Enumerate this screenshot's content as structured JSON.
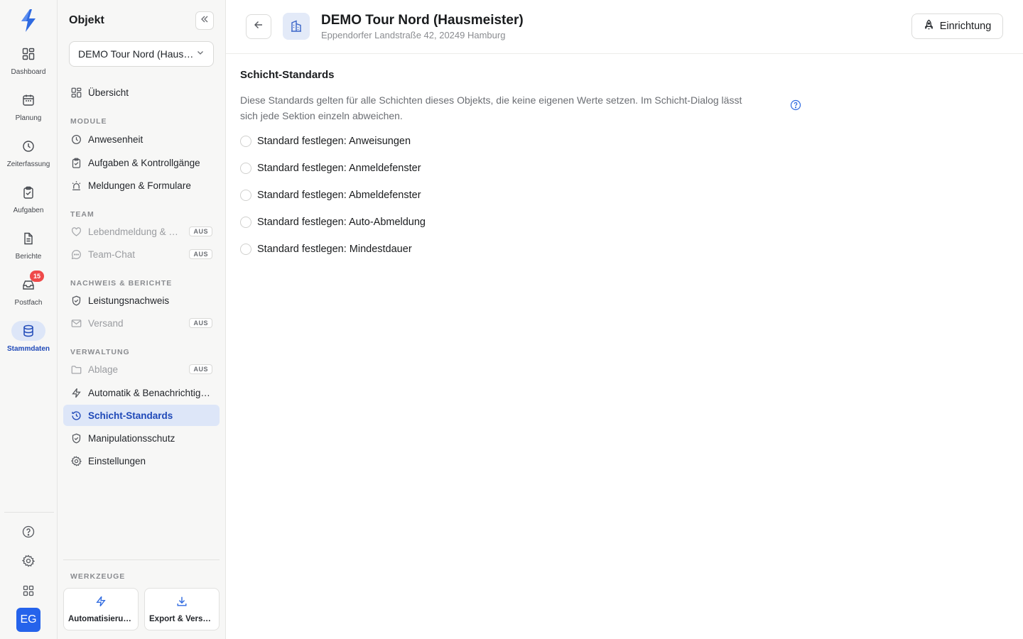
{
  "rail": {
    "items": [
      {
        "label": "Dashboard",
        "icon": "dashboard-icon"
      },
      {
        "label": "Planung",
        "icon": "calendar-icon"
      },
      {
        "label": "Zeiterfassung",
        "icon": "clock-icon"
      },
      {
        "label": "Aufgaben",
        "icon": "clipboard-check-icon"
      },
      {
        "label": "Berichte",
        "icon": "document-icon"
      },
      {
        "label": "Postfach",
        "icon": "inbox-icon",
        "badge": "15"
      },
      {
        "label": "Stammdaten",
        "icon": "database-icon",
        "active": true
      }
    ],
    "avatar": "EG"
  },
  "sidebar": {
    "title": "Objekt",
    "object_select": "DEMO Tour Nord (Hausmeister)",
    "overview": "Übersicht",
    "sections": {
      "module": "MODULE",
      "team": "TEAM",
      "nachweis": "NACHWEIS & BERICHTE",
      "verwaltung": "VERWALTUNG",
      "werkzeuge": "WERKZEUGE"
    },
    "items": {
      "anwesenheit": "Anwesenheit",
      "aufgaben": "Aufgaben & Kontrollgänge",
      "meldungen": "Meldungen & Formulare",
      "lebendmeldung": "Lebendmeldung & Notruf",
      "teamchat": "Team-Chat",
      "leistungsnachweis": "Leistungsnachweis",
      "versand": "Versand",
      "ablage": "Ablage",
      "automatik": "Automatik & Benachrichtigungen",
      "schicht": "Schicht-Standards",
      "manipulation": "Manipulationsschutz",
      "einstellungen": "Einstellungen"
    },
    "off_tag": "AUS",
    "tools": {
      "automatisierung": "Automatisierungen",
      "export": "Export & Versand"
    }
  },
  "header": {
    "title": "DEMO Tour Nord (Hausmeister)",
    "address": "Eppendorfer Landstraße 42, 20249 Hamburg",
    "setup_button": "Einrichtung"
  },
  "content": {
    "title": "Schicht-Standards",
    "description": "Diese Standards gelten für alle Schichten dieses Objekts, die keine eigenen Werte setzen. Im Schicht-Dialog lässt sich jede Sektion einzeln abweichen.",
    "options": [
      {
        "label": "Standard festlegen: Anweisungen",
        "checked": false
      },
      {
        "label": "Standard festlegen: Anmeldefenster",
        "checked": false
      },
      {
        "label": "Standard festlegen: Abmeldefenster",
        "checked": false
      },
      {
        "label": "Standard festlegen: Auto-Abmeldung",
        "checked": false
      },
      {
        "label": "Standard festlegen: Mindestdauer",
        "checked": false
      }
    ]
  },
  "colors": {
    "accent": "#1f49b8",
    "active_bg": "#dde6f8",
    "badge": "#ef4a4a",
    "avatar": "#2563eb"
  }
}
